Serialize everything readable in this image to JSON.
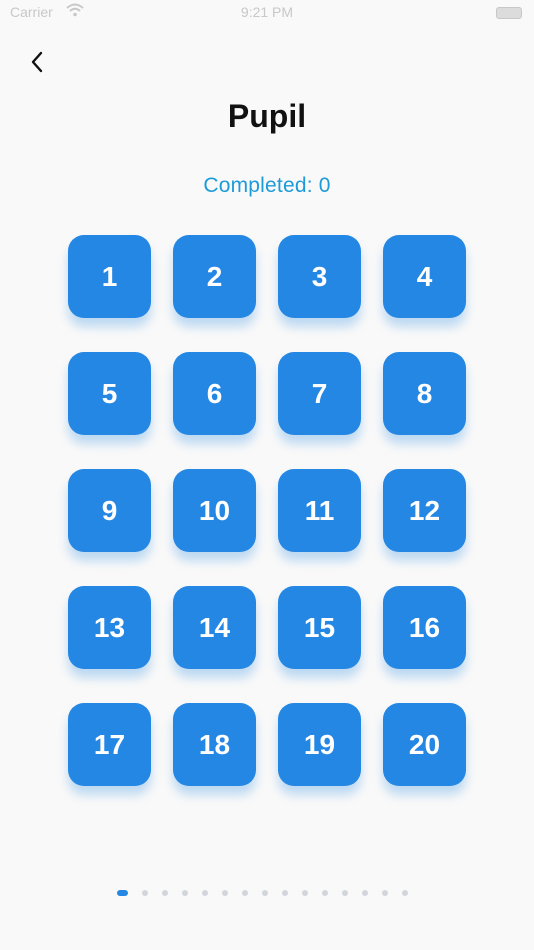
{
  "status_bar": {
    "carrier": "Carrier",
    "time": "9:21 PM"
  },
  "title": "Pupil",
  "completed_text": "Completed: 0",
  "levels": [
    "1",
    "2",
    "3",
    "4",
    "5",
    "6",
    "7",
    "8",
    "9",
    "10",
    "11",
    "12",
    "13",
    "14",
    "15",
    "16",
    "17",
    "18",
    "19",
    "20"
  ],
  "pagination": {
    "total_pages": 15,
    "current_page": 1
  },
  "colors": {
    "accent": "#2587e4",
    "completed_text": "#1d9bd8",
    "background": "#f9f9f9"
  },
  "icons": {
    "back": "chevron-left-icon",
    "wifi": "wifi-icon",
    "battery": "battery-icon"
  }
}
